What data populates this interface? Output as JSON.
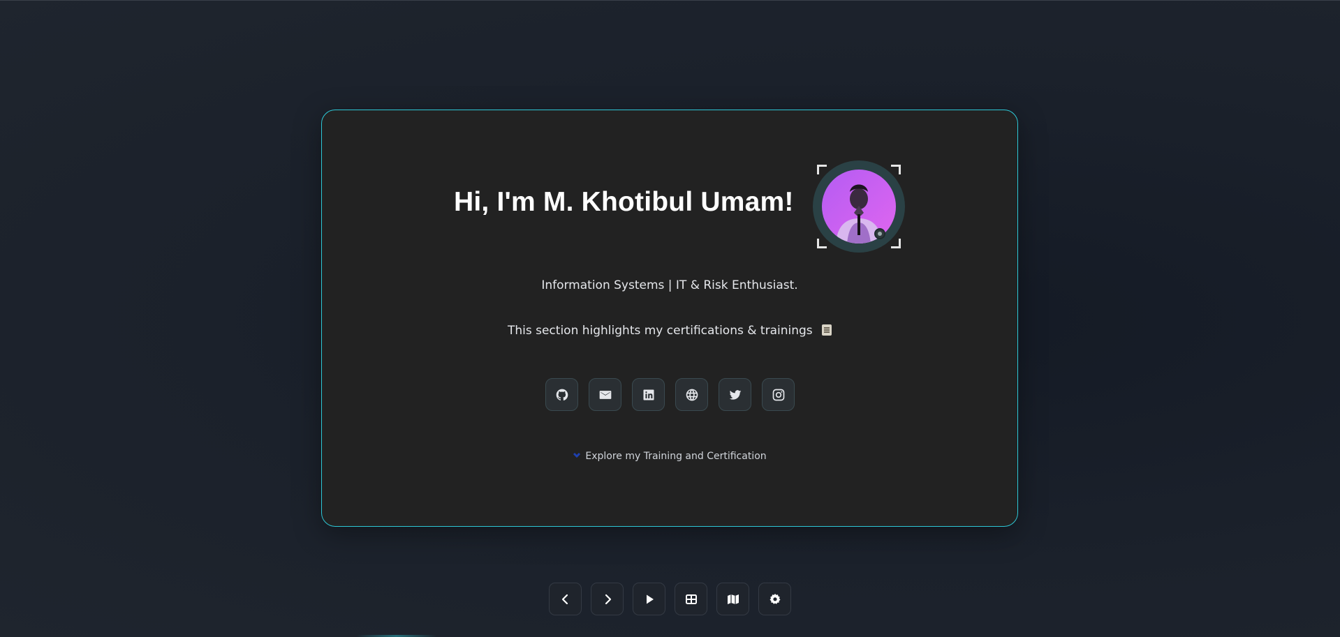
{
  "colors": {
    "card_border": "#2ec8d6",
    "card_bg": "#222222",
    "page_bg": "#1b212b",
    "avatar_bg": "#c65cf7",
    "explore_chevron": "#1e40af"
  },
  "hero": {
    "greeting": "Hi, I'm M. Khotibul Umam!",
    "tagline": "Information Systems | IT & Risk Enthusiast.",
    "section_note": "This section highlights my certifications & trainings",
    "section_note_emoji": "scroll-icon"
  },
  "avatar": {
    "icon": "profile-photo"
  },
  "socials": [
    {
      "icon": "github-icon"
    },
    {
      "icon": "mail-icon"
    },
    {
      "icon": "linkedin-icon"
    },
    {
      "icon": "globe-icon"
    },
    {
      "icon": "twitter-icon"
    },
    {
      "icon": "instagram-icon"
    }
  ],
  "explore": {
    "label": "Explore my Training and Certification",
    "icon": "chevron-down-icon"
  },
  "bottom_nav": [
    {
      "icon": "chevron-left-icon"
    },
    {
      "icon": "chevron-right-icon"
    },
    {
      "icon": "play-icon"
    },
    {
      "icon": "grid-icon"
    },
    {
      "icon": "map-icon"
    },
    {
      "icon": "settings-icon"
    }
  ]
}
